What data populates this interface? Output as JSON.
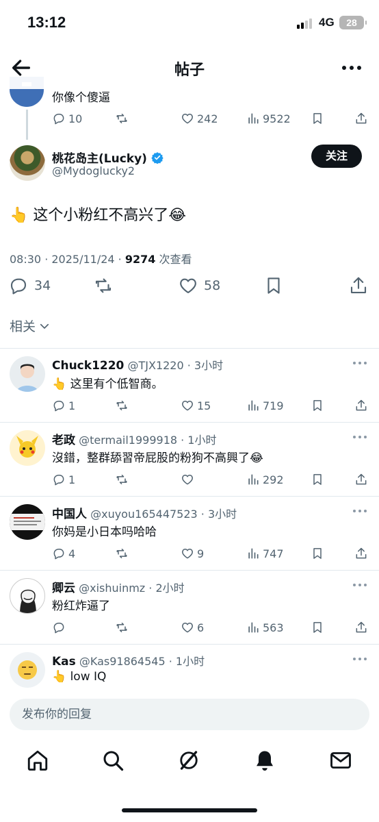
{
  "status_bar": {
    "time": "13:12",
    "network": "4G",
    "battery": "28"
  },
  "header": {
    "title": "帖子"
  },
  "parent_tweet": {
    "text": "你像个傻逼",
    "replies": "10",
    "retweets": "",
    "likes": "242",
    "views": "9522"
  },
  "main_tweet": {
    "author_name": "桃花岛主(Lucky)",
    "handle": "@Mydoglucky2",
    "follow_label": "关注",
    "text": "👆 这个小粉红不高兴了😂",
    "time": "08:30 · 2025/11/24 · ",
    "views_count": "9274",
    "views_label": " 次查看",
    "replies": "34",
    "likes": "58"
  },
  "related_label": "相关",
  "replies": [
    {
      "name": "Chuck1220",
      "handle": "@TJX1220 · 3小时",
      "text": "👆 这里有个低智商。",
      "replies": "1",
      "likes": "15",
      "views": "719"
    },
    {
      "name": "老政",
      "handle": "@termail1999918 · 1小时",
      "text": "沒錯，整群舔習帝屁股的粉狗不高興了😂",
      "replies": "1",
      "likes": "",
      "views": "292"
    },
    {
      "name": "中国人",
      "handle": "@xuyou165447523 · 3小时",
      "text": "你妈是小日本吗哈哈",
      "replies": "4",
      "likes": "9",
      "views": "747"
    },
    {
      "name": "卿云",
      "handle": "@xishuinmz · 2小时",
      "text": "粉红炸逼了",
      "replies": "",
      "likes": "6",
      "views": "563"
    },
    {
      "name": "Kas",
      "handle": "@Kas91864545 · 1小时",
      "text": "👆 low IQ"
    }
  ],
  "compose": {
    "placeholder": "发布你的回复"
  },
  "colors": {
    "text": "#0f1419",
    "secondary": "#536471",
    "verified": "#1d9bf0",
    "divider": "#e1e8ed"
  }
}
